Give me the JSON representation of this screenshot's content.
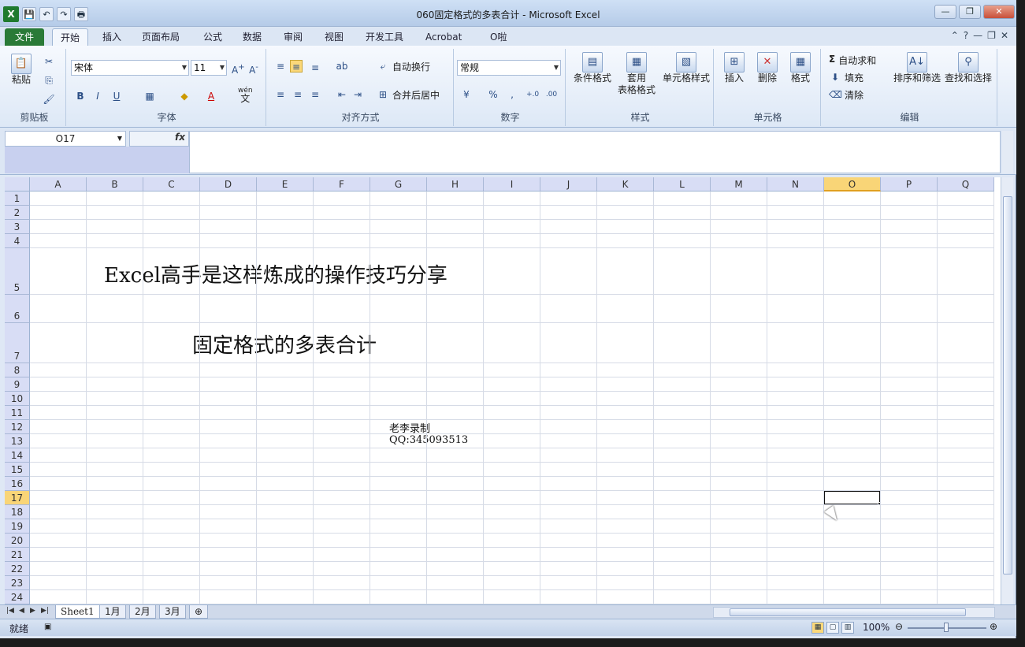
{
  "window": {
    "title": "060固定格式的多表合计 - Microsoft Excel"
  },
  "qat": {
    "logo": "X",
    "save": "💾",
    "undo": "↶",
    "redo": "↷",
    "print_preview": "🖶"
  },
  "controls": {
    "min": "—",
    "max": "❐",
    "close": "✕"
  },
  "tabs": [
    {
      "label": "文件"
    },
    {
      "label": "开始"
    },
    {
      "label": "插入"
    },
    {
      "label": "页面布局"
    },
    {
      "label": "公式"
    },
    {
      "label": "数据"
    },
    {
      "label": "审阅"
    },
    {
      "label": "视图"
    },
    {
      "label": "开发工具"
    },
    {
      "label": "Acrobat"
    },
    {
      "label": "O啦"
    }
  ],
  "ribbon": {
    "clipboard": {
      "paste": "粘贴",
      "group": "剪贴板"
    },
    "font": {
      "name": "宋体",
      "size": "11",
      "bold": "B",
      "italic": "I",
      "underline": "U",
      "wen": "wén",
      "wen2": "文",
      "group": "字体"
    },
    "align": {
      "wrap": "自动换行",
      "merge": "合并后居中",
      "group": "对齐方式"
    },
    "number": {
      "format": "常规",
      "percent": "%",
      "comma": ",",
      "inc": "+.0",
      "dec": ".00",
      "group": "数字"
    },
    "styles": {
      "cond": "条件格式",
      "table1": "套用",
      "table2": "表格格式",
      "cell": "单元格样式",
      "group": "样式"
    },
    "cells": {
      "insert": "插入",
      "delete": "删除",
      "format": "格式",
      "group": "单元格"
    },
    "editing": {
      "autosum": "自动求和",
      "fill": "填充",
      "clear": "清除",
      "sort": "排序和筛选",
      "find": "查找和选择",
      "group": "编辑"
    }
  },
  "formula_bar": {
    "name_box": "O17",
    "fx": "fx",
    "content": ""
  },
  "grid": {
    "columns": [
      "A",
      "B",
      "C",
      "D",
      "E",
      "F",
      "G",
      "H",
      "I",
      "J",
      "K",
      "L",
      "M",
      "N",
      "O",
      "P",
      "Q"
    ],
    "rows": [
      "1",
      "2",
      "3",
      "4",
      "5",
      "6",
      "7",
      "8",
      "9",
      "10",
      "11",
      "12",
      "13",
      "14",
      "15",
      "16",
      "17",
      "18",
      "19",
      "20",
      "21",
      "22",
      "23",
      "24"
    ],
    "selected_cell": "O17",
    "cells": {
      "r5": "Excel高手是这样炼成的操作技巧分享",
      "r7": "固定格式的多表合计",
      "r12": "老李录制",
      "r13": "QQ:345093513"
    }
  },
  "sheets": [
    "Sheet1",
    "1月",
    "2月",
    "3月"
  ],
  "status": {
    "ready": "就绪",
    "zoom": "100%"
  }
}
